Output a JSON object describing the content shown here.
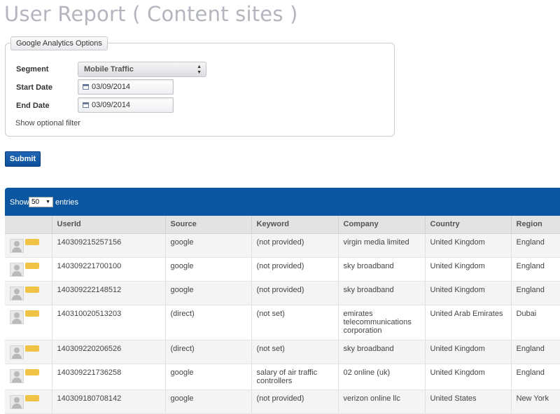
{
  "page": {
    "title": "User Report ( Content sites )"
  },
  "form": {
    "legend": "Google Analytics Options",
    "segment_label": "Segment",
    "segment_value": "Mobile Traffic",
    "start_label": "Start Date",
    "start_value": "03/09/2014",
    "end_label": "End Date",
    "end_value": "03/09/2014",
    "filter_link": "Show optional filter",
    "submit_label": "Submit"
  },
  "table": {
    "show_label": "Show",
    "page_size": "50",
    "entries_label": "entries",
    "columns": [
      "",
      "UserId",
      "Source",
      "Keyword",
      "Company",
      "Country",
      "Region"
    ],
    "rows": [
      {
        "userid": "140309215257156",
        "source": "google",
        "keyword": "(not provided)",
        "company": "virgin media limited",
        "country": "United Kingdom",
        "region": "England"
      },
      {
        "userid": "140309221700100",
        "source": "google",
        "keyword": "(not provided)",
        "company": "sky broadband",
        "country": "United Kingdom",
        "region": "England"
      },
      {
        "userid": "140309222148512",
        "source": "google",
        "keyword": "(not provided)",
        "company": "sky broadband",
        "country": "United Kingdom",
        "region": "England"
      },
      {
        "userid": "140310020513203",
        "source": "(direct)",
        "keyword": "(not set)",
        "company": "emirates telecommunications corporation",
        "country": "United Arab Emirates",
        "region": "Dubai"
      },
      {
        "userid": "140309220206526",
        "source": "(direct)",
        "keyword": "(not set)",
        "company": "sky broadband",
        "country": "United Kingdom",
        "region": "England"
      },
      {
        "userid": "140309221736258",
        "source": "google",
        "keyword": "salary of air traffic controllers",
        "company": "02 online (uk)",
        "country": "United Kingdom",
        "region": "England"
      },
      {
        "userid": "140309180708142",
        "source": "google",
        "keyword": "(not provided)",
        "company": "verizon online llc",
        "country": "United States",
        "region": "New York"
      }
    ]
  }
}
